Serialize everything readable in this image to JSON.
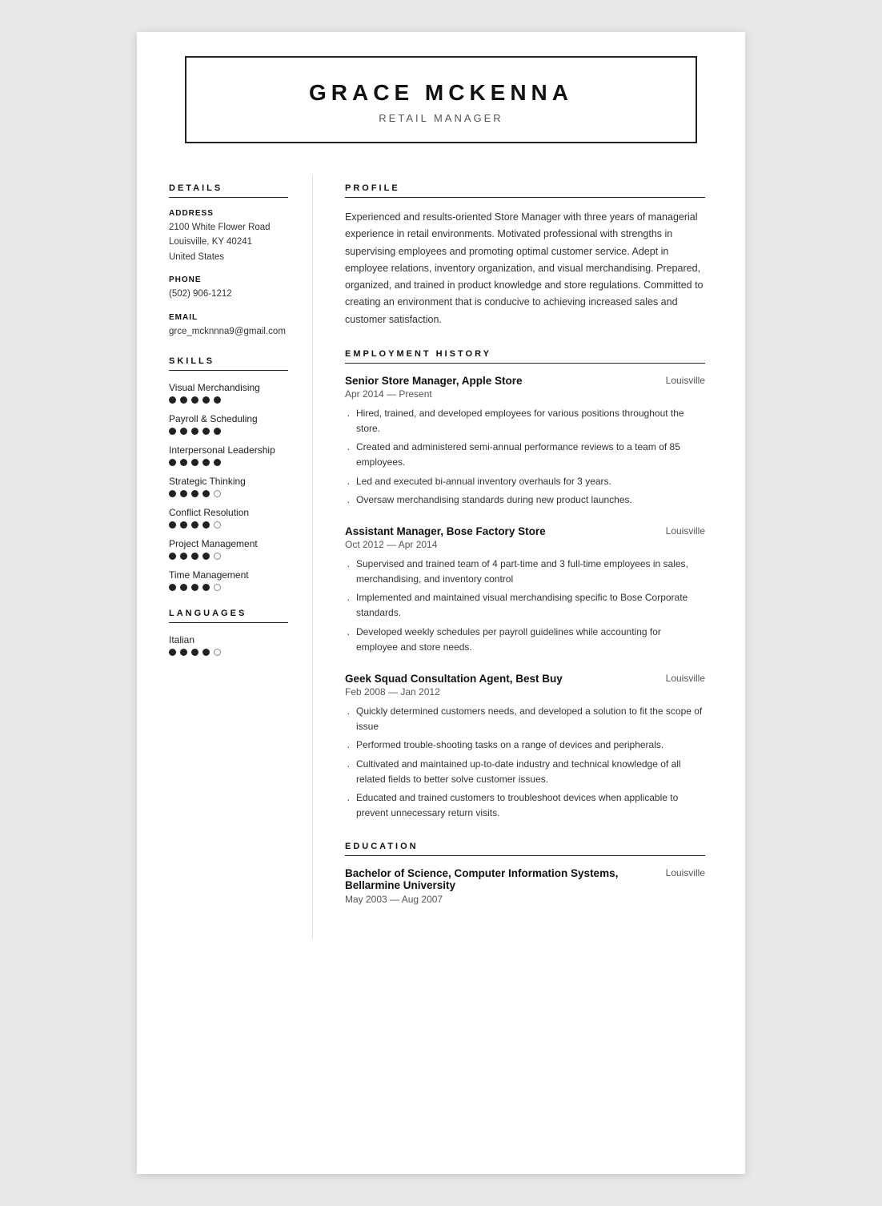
{
  "header": {
    "name": "GRACE MCKENNA",
    "title": "RETAIL MANAGER"
  },
  "sidebar": {
    "details_label": "DETAILS",
    "address_label": "ADDRESS",
    "address_line1": "2100 White Flower Road",
    "address_line2": "Louisville, KY 40241",
    "address_line3": "United States",
    "phone_label": "PHONE",
    "phone": "(502) 906-1212",
    "email_label": "EMAIL",
    "email": "grce_mcknnna9@gmail.com",
    "skills_label": "SKILLS",
    "skills": [
      {
        "name": "Visual Merchandising",
        "filled": 5,
        "empty": 0
      },
      {
        "name": "Payroll & Scheduling",
        "filled": 5,
        "empty": 0
      },
      {
        "name": "Interpersonal Leadership",
        "filled": 5,
        "empty": 0
      },
      {
        "name": "Strategic Thinking",
        "filled": 4,
        "empty": 1
      },
      {
        "name": "Conflict Resolution",
        "filled": 4,
        "empty": 1
      },
      {
        "name": "Project Management",
        "filled": 4,
        "empty": 1
      },
      {
        "name": "Time Management",
        "filled": 4,
        "empty": 1
      }
    ],
    "languages_label": "LANGUAGES",
    "languages": [
      {
        "name": "Italian",
        "filled": 4,
        "empty": 1
      }
    ]
  },
  "content": {
    "profile_label": "PROFILE",
    "profile_text": "Experienced and results-oriented Store Manager with three years of managerial experience in retail environments. Motivated professional with strengths in supervising employees and promoting optimal customer service. Adept in employee relations, inventory organization, and visual merchandising. Prepared, organized, and trained in product knowledge and store regulations. Committed to creating an environment that is conducive to achieving increased sales and customer satisfaction.",
    "employment_label": "EMPLOYMENT HISTORY",
    "jobs": [
      {
        "title": "Senior Store Manager, Apple Store",
        "location": "Louisville",
        "dates": "Apr 2014 — Present",
        "bullets": [
          "Hired, trained, and developed employees for various positions throughout the store.",
          "Created and administered semi-annual performance reviews to a team of 85 employees.",
          "Led and executed bi-annual inventory overhauls for 3 years.",
          "Oversaw merchandising standards during new product launches."
        ]
      },
      {
        "title": "Assistant Manager, Bose Factory Store",
        "location": "Louisville",
        "dates": "Oct 2012 — Apr 2014",
        "bullets": [
          "Supervised and trained team of 4 part-time and 3 full-time employees in sales, merchandising, and inventory control",
          "Implemented and maintained visual merchandising specific to Bose Corporate standards.",
          "Developed weekly schedules per payroll guidelines while accounting for employee and store needs."
        ]
      },
      {
        "title": "Geek Squad Consultation Agent, Best Buy",
        "location": "Louisville",
        "dates": "Feb 2008 — Jan 2012",
        "bullets": [
          "Quickly determined customers needs, and developed a solution to fit the scope of issue",
          "Performed trouble-shooting tasks on a range of devices and peripherals.",
          "Cultivated and maintained up-to-date industry and technical knowledge of all related fields to better solve customer issues.",
          "Educated and trained customers to troubleshoot devices when applicable to prevent unnecessary return visits."
        ]
      }
    ],
    "education_label": "EDUCATION",
    "education": [
      {
        "title": "Bachelor of Science, Computer Information Systems, Bellarmine University",
        "location": "Louisville",
        "dates": "May 2003 — Aug 2007"
      }
    ]
  }
}
